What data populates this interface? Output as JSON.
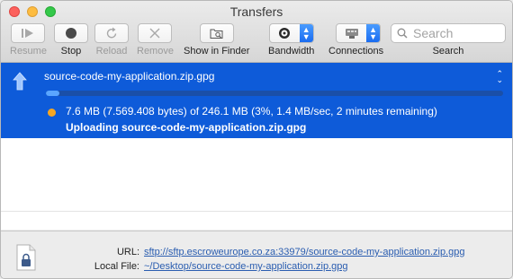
{
  "window": {
    "title": "Transfers"
  },
  "toolbar": {
    "resume_label": "Resume",
    "stop_label": "Stop",
    "reload_label": "Reload",
    "remove_label": "Remove",
    "show_in_finder_label": "Show in Finder",
    "bandwidth_label": "Bandwidth",
    "connections_label": "Connections",
    "search_label": "Search",
    "search_placeholder": "Search"
  },
  "transfer": {
    "filename": "source-code-my-application.zip.gpg",
    "progress_fraction": 0.03,
    "status_text": "7.6 MB (7.569.408 bytes) of 246.1 MB (3%, 1.4 MB/sec, 2 minutes remaining)",
    "status_bold": "Uploading source-code-my-application.zip.gpg",
    "status_color": "#f5a623"
  },
  "footer": {
    "url_label": "URL:",
    "url_value": "sftp://sftp.escroweurope.co.za:33979/source-code-my-application.zip.gpg",
    "local_file_label": "Local File:",
    "local_file_value": "~/Desktop/source-code-my-application.zip.gpg"
  },
  "colors": {
    "selection": "#0e5bd9",
    "link": "#2a5db0",
    "accent": "#1a6cf0"
  }
}
